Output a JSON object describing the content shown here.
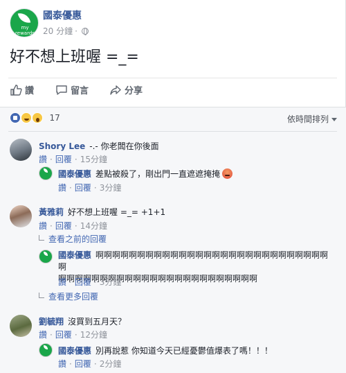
{
  "post": {
    "page_name": "國泰優惠",
    "avatar_brand_line1": "my",
    "avatar_brand_line2": "rewards",
    "time": "20 分鐘",
    "text": "好不想上班喔 =_="
  },
  "actions": {
    "like": "讚",
    "comment": "留言",
    "share": "分享"
  },
  "reactions": {
    "types": [
      "like",
      "haha",
      "wow"
    ],
    "count": "17"
  },
  "sort_label": "依時間排列",
  "comments": [
    {
      "author": "Shory Lee",
      "text": "-.- 你老闆在你後面",
      "like": "讚",
      "reply": "回覆",
      "time": "15分鐘",
      "reply_item": {
        "author": "國泰優惠",
        "text": "差點被殺了，剛出門一直遮遮掩掩",
        "like": "讚",
        "reply": "回覆",
        "time": "3分鐘"
      }
    },
    {
      "author": "黃雅莉",
      "text": "好不想上班喔 =_= +1+1",
      "like": "讚",
      "reply": "回覆",
      "time": "14分鐘",
      "view_previous": "查看之前的回覆",
      "reply_item": {
        "author": "國泰優惠",
        "text_line1": "啊啊啊啊啊啊啊啊啊啊啊啊啊啊啊啊啊啊啊啊啊啊啊啊啊啊啊啊啊",
        "text_line2": "啊啊啊啊啊啊啊啊啊啊啊啊啊啊啊啊啊啊啊啊啊啊啊啊",
        "like": "讚",
        "reply": "回覆",
        "time": "3分鐘"
      },
      "view_more": "查看更多回覆"
    },
    {
      "author": "劉毓翔",
      "text": "沒買到五月天？",
      "like": "讚",
      "reply": "回覆",
      "time": "12分鐘",
      "reply_item": {
        "author": "國泰優惠",
        "text": "別再說惹  你知道今天已經憂鬱值爆表了嗎！！！",
        "like": "讚",
        "reply": "回覆",
        "time": "2分鐘"
      }
    }
  ],
  "colors": {
    "link": "#365899",
    "brand_green": "#1aa64a",
    "muted": "#90949c"
  }
}
